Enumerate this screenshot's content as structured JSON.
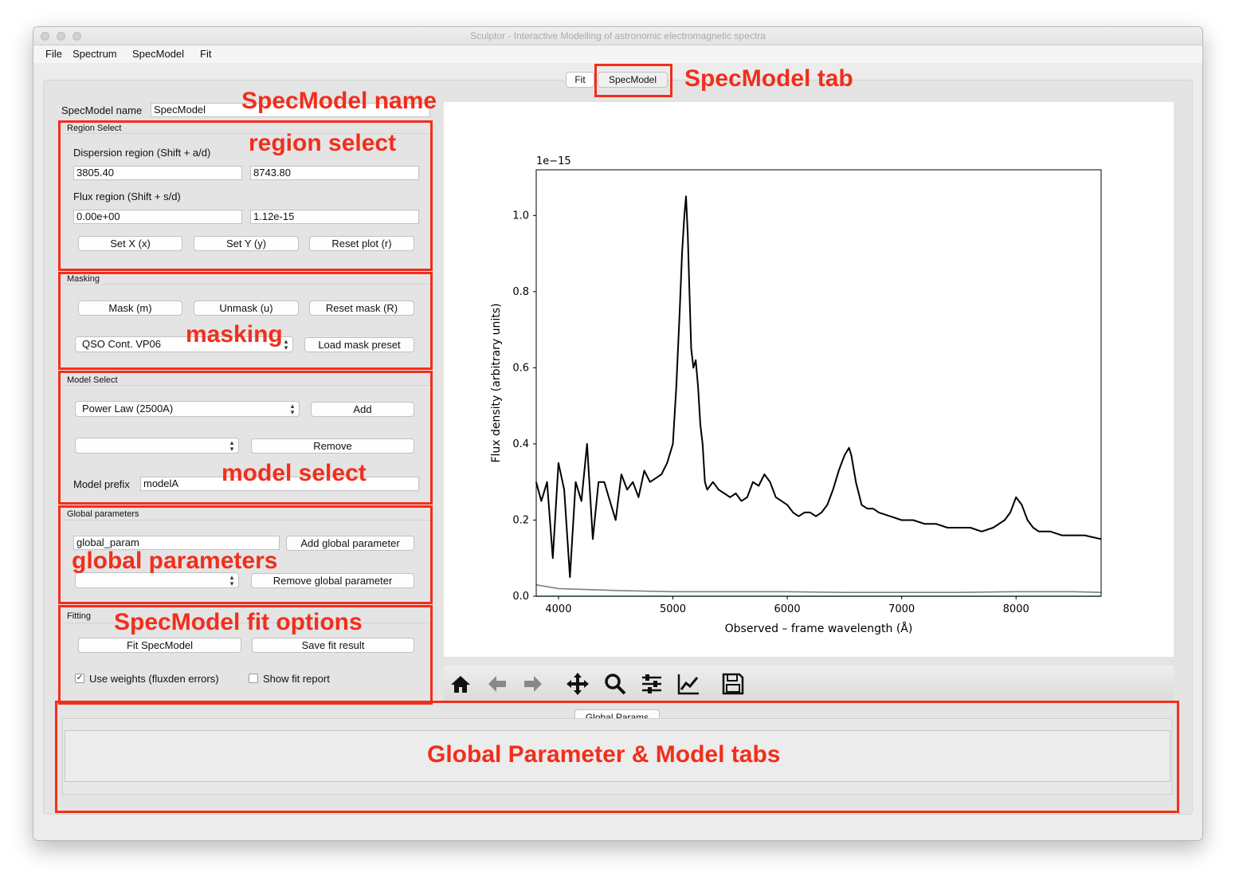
{
  "window": {
    "title": "Sculptor - Interactive Modelling of astronomic electromagnetic spectra"
  },
  "menu": [
    "File",
    "Spectrum",
    "SpecModel",
    "Fit"
  ],
  "tabs": {
    "fit": "Fit",
    "specmodel": "SpecModel"
  },
  "specmodel_name": {
    "label": "SpecModel name",
    "value": "SpecModel"
  },
  "region_select": {
    "title": "Region Select",
    "dispersion_label": "Dispersion region (Shift + a/d)",
    "disp_min": "3805.40",
    "disp_max": "8743.80",
    "flux_label": "Flux region (Shift + s/d)",
    "flux_min": "0.00e+00",
    "flux_max": "1.12e-15",
    "set_x": "Set X (x)",
    "set_y": "Set Y (y)",
    "reset_plot": "Reset plot (r)"
  },
  "masking": {
    "title": "Masking",
    "mask": "Mask (m)",
    "unmask": "Unmask (u)",
    "reset_mask": "Reset mask (R)",
    "preset": "QSO Cont. VP06",
    "load_preset": "Load mask preset"
  },
  "model_select": {
    "title": "Model Select",
    "model": "Power Law (2500A)",
    "add": "Add",
    "current": "",
    "remove": "Remove",
    "prefix_label": "Model prefix",
    "prefix_value": "modelA"
  },
  "global_parameters": {
    "title": "Global parameters",
    "param_value": "global_param",
    "add": "Add global parameter",
    "current": "",
    "remove": "Remove global parameter"
  },
  "fitting": {
    "title": "Fitting",
    "fit": "Fit SpecModel",
    "save": "Save fit result",
    "use_weights": "Use weights (fluxden errors)",
    "use_weights_checked": true,
    "show_report": "Show fit report",
    "show_report_checked": false
  },
  "bottom_tabs": {
    "global_params": "Global Params"
  },
  "toolbar_icons": [
    "home-icon",
    "back-arrow-icon",
    "forward-arrow-icon",
    "pan-icon",
    "zoom-icon",
    "configure-subplots-icon",
    "edit-axis-icon",
    "save-icon"
  ],
  "annotations": {
    "specmodel_tab": "SpecModel tab",
    "specmodel_name": "SpecModel name",
    "region_select": "region select",
    "masking": "masking",
    "model_select": "model select",
    "global_parameters": "global parameters",
    "fit_options": "SpecModel fit options",
    "bottom_tabs": "Global Parameter & Model  tabs"
  },
  "colors": {
    "annotation": "#f22e1c",
    "flux": "#000000",
    "error": "#808080",
    "model": "#2a9d8f"
  },
  "chart_data": {
    "type": "line",
    "title": "",
    "offset_label": "1e−15",
    "xlabel": "Observed – frame wavelength (Å)",
    "ylabel": "Flux density (arbitrary units)",
    "xlim": [
      3805.4,
      8743.8
    ],
    "ylim": [
      0.0,
      1.12
    ],
    "xticks": [
      4000,
      5000,
      6000,
      7000,
      8000
    ],
    "yticks": [
      0.0,
      0.2,
      0.4,
      0.6,
      0.8,
      1.0
    ],
    "ytick_labels": [
      "0.0",
      "0.2",
      "0.4",
      "0.6",
      "0.8",
      "1.0"
    ],
    "series": [
      {
        "color": "#000000",
        "x": [
          3805,
          3850,
          3900,
          3950,
          4000,
          4050,
          4100,
          4150,
          4200,
          4250,
          4300,
          4350,
          4400,
          4450,
          4500,
          4550,
          4600,
          4650,
          4700,
          4750,
          4800,
          4850,
          4900,
          4950,
          5000,
          5030,
          5060,
          5080,
          5100,
          5115,
          5130,
          5145,
          5160,
          5180,
          5200,
          5220,
          5240,
          5260,
          5280,
          5300,
          5350,
          5400,
          5450,
          5500,
          5550,
          5600,
          5650,
          5700,
          5750,
          5800,
          5850,
          5900,
          5950,
          6000,
          6050,
          6100,
          6150,
          6200,
          6250,
          6300,
          6350,
          6400,
          6450,
          6500,
          6540,
          6560,
          6600,
          6650,
          6700,
          6750,
          6800,
          6900,
          7000,
          7100,
          7200,
          7300,
          7400,
          7500,
          7600,
          7700,
          7800,
          7900,
          7950,
          8000,
          8050,
          8100,
          8150,
          8200,
          8300,
          8400,
          8500,
          8600,
          8743
        ],
        "y": [
          0.3,
          0.25,
          0.3,
          0.1,
          0.35,
          0.28,
          0.05,
          0.3,
          0.25,
          0.4,
          0.15,
          0.3,
          0.3,
          0.25,
          0.2,
          0.32,
          0.28,
          0.3,
          0.26,
          0.33,
          0.3,
          0.31,
          0.32,
          0.35,
          0.4,
          0.55,
          0.75,
          0.9,
          1.0,
          1.05,
          0.95,
          0.8,
          0.65,
          0.6,
          0.62,
          0.55,
          0.45,
          0.4,
          0.3,
          0.28,
          0.3,
          0.28,
          0.27,
          0.26,
          0.27,
          0.25,
          0.26,
          0.3,
          0.29,
          0.32,
          0.3,
          0.26,
          0.25,
          0.24,
          0.22,
          0.21,
          0.22,
          0.22,
          0.21,
          0.22,
          0.24,
          0.28,
          0.33,
          0.37,
          0.39,
          0.37,
          0.3,
          0.24,
          0.23,
          0.23,
          0.22,
          0.21,
          0.2,
          0.2,
          0.19,
          0.19,
          0.18,
          0.18,
          0.18,
          0.17,
          0.18,
          0.2,
          0.22,
          0.26,
          0.24,
          0.2,
          0.18,
          0.17,
          0.17,
          0.16,
          0.16,
          0.16,
          0.15
        ]
      },
      {
        "color": "#808080",
        "x": [
          3805,
          4000,
          4500,
          5000,
          5500,
          6000,
          6500,
          7000,
          7500,
          8000,
          8500,
          8743
        ],
        "y": [
          0.03,
          0.02,
          0.015,
          0.012,
          0.012,
          0.012,
          0.01,
          0.01,
          0.01,
          0.012,
          0.012,
          0.01
        ]
      },
      {
        "color": "#2a9d8f",
        "x": [
          3805,
          8743
        ],
        "y": [
          0.0,
          0.0
        ]
      }
    ]
  }
}
